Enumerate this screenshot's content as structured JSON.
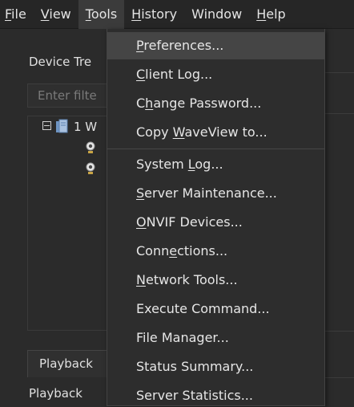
{
  "menubar": {
    "items": [
      {
        "pre": "",
        "key": "F",
        "post": "ile"
      },
      {
        "pre": "",
        "key": "V",
        "post": "iew"
      },
      {
        "pre": "",
        "key": "T",
        "post": "ools"
      },
      {
        "pre": "",
        "key": "H",
        "post": "istory"
      },
      {
        "pre": "Window",
        "key": "",
        "post": ""
      },
      {
        "pre": "",
        "key": "H",
        "post": "elp"
      }
    ]
  },
  "panel": {
    "title": "Device Tre",
    "filter_placeholder": "Enter filte",
    "tree_root": "1 W"
  },
  "tabs": {
    "playback_tab": "Playback",
    "playback_label": "Playback"
  },
  "dropdown": {
    "items": [
      {
        "pre": "",
        "key": "P",
        "post": "references..."
      },
      {
        "pre": "",
        "key": "C",
        "post": "lient Log..."
      },
      {
        "pre": "C",
        "key": "h",
        "post": "ange Password..."
      },
      {
        "pre": "Copy ",
        "key": "W",
        "post": "aveView to..."
      },
      {
        "pre": "System ",
        "key": "L",
        "post": "og..."
      },
      {
        "pre": "",
        "key": "S",
        "post": "erver Maintenance..."
      },
      {
        "pre": "",
        "key": "O",
        "post": "NVIF Devices..."
      },
      {
        "pre": "Conn",
        "key": "e",
        "post": "ctions..."
      },
      {
        "pre": "",
        "key": "N",
        "post": "etwork Tools..."
      },
      {
        "pre": "Execute Command...",
        "key": "",
        "post": ""
      },
      {
        "pre": "File Manager...",
        "key": "",
        "post": ""
      },
      {
        "pre": "Status Summary...",
        "key": "",
        "post": ""
      },
      {
        "pre": "Server Statistics...",
        "key": "",
        "post": ""
      }
    ]
  }
}
